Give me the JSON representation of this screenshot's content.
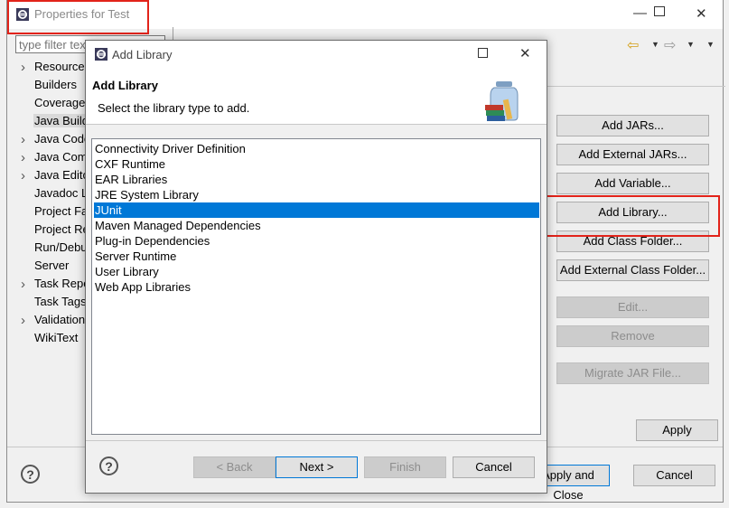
{
  "props_window": {
    "title": "Properties for Test",
    "filter_placeholder": "type filter text",
    "tree": [
      {
        "label": "Resource",
        "expandable": true
      },
      {
        "label": "Builders",
        "expandable": false
      },
      {
        "label": "Coverage",
        "expandable": false
      },
      {
        "label": "Java Build Path",
        "expandable": false,
        "selected": true
      },
      {
        "label": "Java Code Style",
        "expandable": true
      },
      {
        "label": "Java Compiler",
        "expandable": true
      },
      {
        "label": "Java Editor",
        "expandable": true
      },
      {
        "label": "Javadoc Location",
        "expandable": false
      },
      {
        "label": "Project Facets",
        "expandable": false
      },
      {
        "label": "Project References",
        "expandable": false
      },
      {
        "label": "Run/Debug Settings",
        "expandable": false
      },
      {
        "label": "Server",
        "expandable": false
      },
      {
        "label": "Task Repository",
        "expandable": true
      },
      {
        "label": "Task Tags",
        "expandable": false
      },
      {
        "label": "Validation",
        "expandable": true
      },
      {
        "label": "WikiText",
        "expandable": false
      }
    ],
    "side_buttons": {
      "add_jars": "Add JARs...",
      "add_external_jars": "Add External JARs...",
      "add_variable": "Add Variable...",
      "add_library": "Add Library...",
      "add_class_folder": "Add Class Folder...",
      "add_external_class_folder": "Add External Class Folder...",
      "edit": "Edit...",
      "remove": "Remove",
      "migrate_jar": "Migrate JAR File..."
    },
    "apply": "Apply",
    "apply_and_close": "Apply and Close",
    "cancel": "Cancel",
    "help_glyph": "?",
    "highlight_color": "#e2231a"
  },
  "dialog": {
    "title": "Add Library",
    "heading": "Add Library",
    "description": "Select the library type to add.",
    "libraries": [
      "Connectivity Driver Definition",
      "CXF Runtime",
      "EAR Libraries",
      "JRE System Library",
      "JUnit",
      "Maven Managed Dependencies",
      "Plug-in Dependencies",
      "Server Runtime",
      "User Library",
      "Web App Libraries"
    ],
    "selected_library": "JUnit",
    "buttons": {
      "back": "< Back",
      "next": "Next >",
      "finish": "Finish",
      "cancel": "Cancel"
    },
    "help_glyph": "?",
    "selection_color": "#0078d7"
  },
  "window_controls": {
    "minimize": "—",
    "close": "✕"
  }
}
